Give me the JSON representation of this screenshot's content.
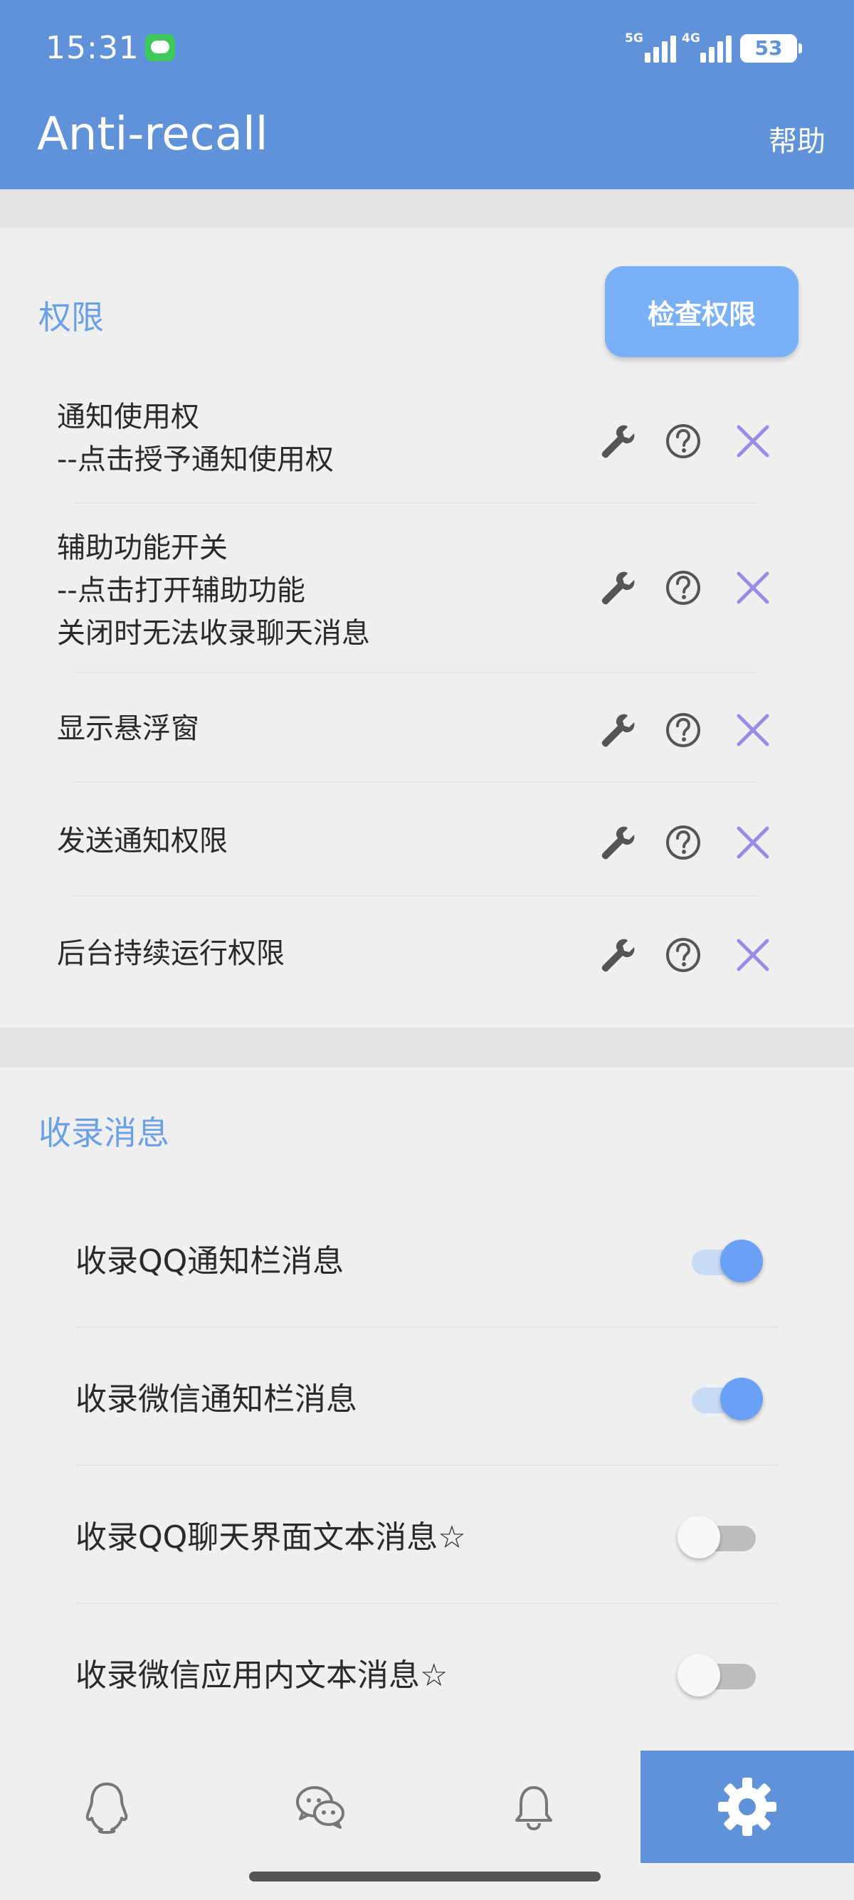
{
  "status_bar": {
    "time": "15:31",
    "sim1": "5G",
    "sim2": "4G",
    "battery": "53"
  },
  "app_bar": {
    "title": "Anti-recall",
    "help": "帮助"
  },
  "permissions": {
    "title": "权限",
    "check_button": "检查权限",
    "items": [
      {
        "lines": [
          "通知使用权",
          "--点击授予通知使用权"
        ]
      },
      {
        "lines": [
          "辅助功能开关",
          "--点击打开辅助功能",
          "关闭时无法收录聊天消息"
        ]
      },
      {
        "lines": [
          "显示悬浮窗"
        ]
      },
      {
        "lines": [
          "发送通知权限"
        ]
      },
      {
        "lines": [
          "后台持续运行权限"
        ]
      }
    ]
  },
  "record": {
    "title": "收录消息",
    "items": [
      {
        "label": "收录QQ通知栏消息",
        "on": true
      },
      {
        "label": "收录微信通知栏消息",
        "on": true
      },
      {
        "label": "收录QQ聊天界面文本消息☆",
        "on": false
      },
      {
        "label": "收录微信应用内文本消息☆",
        "on": false
      }
    ]
  },
  "bottom_nav": {
    "items": [
      "qq-icon",
      "wechat-icon",
      "bell-icon",
      "gear-icon"
    ],
    "active_index": 3
  },
  "colors": {
    "primary": "#5f92d8",
    "accent": "#6aa0e6",
    "close_x": "#9b8ae6"
  }
}
